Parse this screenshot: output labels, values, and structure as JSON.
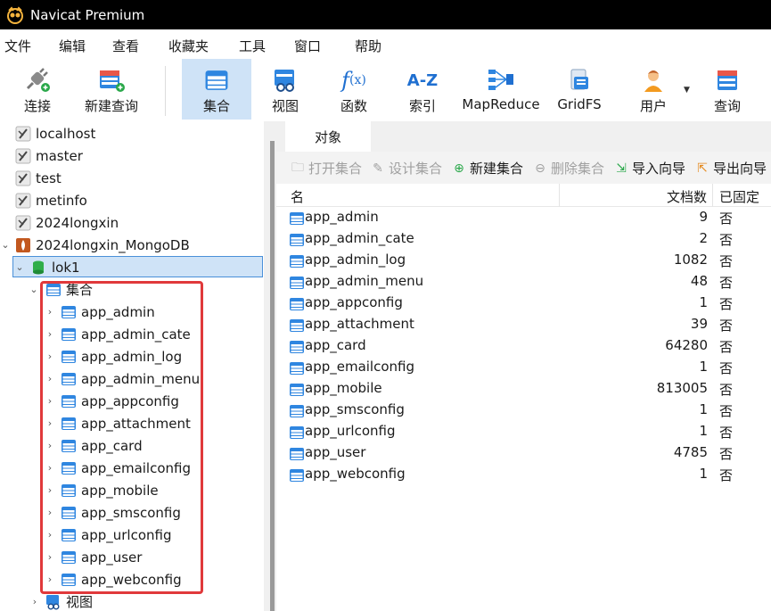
{
  "window": {
    "title": "Navicat Premium"
  },
  "menu": [
    "文件",
    "编辑",
    "查看",
    "收藏夹",
    "工具",
    "窗口",
    "帮助"
  ],
  "toolbar": {
    "connect": "连接",
    "new_query": "新建查询",
    "collection": "集合",
    "view": "视图",
    "function": "函数",
    "index": "索引",
    "mapreduce": "MapReduce",
    "gridfs": "GridFS",
    "user": "用户",
    "query": "查询"
  },
  "tree": {
    "connections": [
      "localhost",
      "master",
      "test",
      "metinfo",
      "2024longxin",
      "2024longxin_MongoDB"
    ],
    "database": "lok1",
    "collections_folder": "集合",
    "collections": [
      "app_admin",
      "app_admin_cate",
      "app_admin_log",
      "app_admin_menu",
      "app_appconfig",
      "app_attachment",
      "app_card",
      "app_emailconfig",
      "app_mobile",
      "app_smsconfig",
      "app_urlconfig",
      "app_user",
      "app_webconfig"
    ],
    "views_folder": "视图"
  },
  "objects_tab": {
    "label": "对象"
  },
  "actions": {
    "open": "打开集合",
    "design": "设计集合",
    "new": "新建集合",
    "delete": "删除集合",
    "import": "导入向导",
    "export": "导出向导"
  },
  "grid": {
    "headers": {
      "name": "名",
      "docs": "文档数",
      "pinned": "已固定"
    },
    "rows": [
      {
        "name": "app_admin",
        "docs": "9",
        "pinned": "否"
      },
      {
        "name": "app_admin_cate",
        "docs": "2",
        "pinned": "否"
      },
      {
        "name": "app_admin_log",
        "docs": "1082",
        "pinned": "否"
      },
      {
        "name": "app_admin_menu",
        "docs": "48",
        "pinned": "否"
      },
      {
        "name": "app_appconfig",
        "docs": "1",
        "pinned": "否"
      },
      {
        "name": "app_attachment",
        "docs": "39",
        "pinned": "否"
      },
      {
        "name": "app_card",
        "docs": "64280",
        "pinned": "否"
      },
      {
        "name": "app_emailconfig",
        "docs": "1",
        "pinned": "否"
      },
      {
        "name": "app_mobile",
        "docs": "813005",
        "pinned": "否"
      },
      {
        "name": "app_smsconfig",
        "docs": "1",
        "pinned": "否"
      },
      {
        "name": "app_urlconfig",
        "docs": "1",
        "pinned": "否"
      },
      {
        "name": "app_user",
        "docs": "4785",
        "pinned": "否"
      },
      {
        "name": "app_webconfig",
        "docs": "1",
        "pinned": "否"
      }
    ]
  },
  "colors": {
    "selection": "#cfe3f7",
    "selection_border": "#4a90d9",
    "highlight_box": "#e0393b",
    "title_bar": "#000000"
  }
}
